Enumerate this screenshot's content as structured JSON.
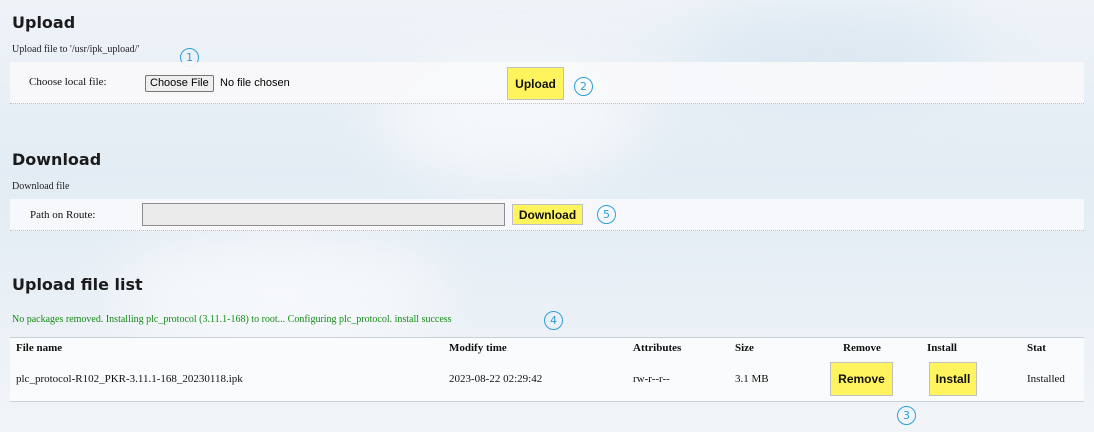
{
  "upload": {
    "title": "Upload",
    "subtitle": "Upload file to '/usr/ipk_upload/'",
    "local_label": "Choose local file:",
    "choose_button": "Choose File",
    "no_file": "No file chosen",
    "upload_button": "Upload"
  },
  "download": {
    "title": "Download",
    "subtitle": "Download file",
    "path_label": "Path on Route:",
    "path_value": "",
    "download_button": "Download"
  },
  "file_list": {
    "title": "Upload file list",
    "status_message": "No packages removed. Installing plc_protocol (3.11.1-168) to root... Configuring plc_protocol. install success",
    "columns": [
      "File name",
      "Modify time",
      "Attributes",
      "Size",
      "Remove",
      "Install",
      "Stat"
    ],
    "rows": [
      {
        "file_name": "plc_protocol-R102_PKR-3.11.1-168_20230118.ipk",
        "modify_time": "2023-08-22 02:29:42",
        "attributes": "rw-r--r--",
        "size": "3.1 MB",
        "remove_label": "Remove",
        "install_label": "Install",
        "stat": "Installed"
      }
    ]
  },
  "callouts": [
    "1",
    "2",
    "3",
    "4",
    "5"
  ],
  "colors": {
    "button_yellow": "#fff35e",
    "callout_blue": "#2e9fd8",
    "success_green": "#168a16"
  }
}
